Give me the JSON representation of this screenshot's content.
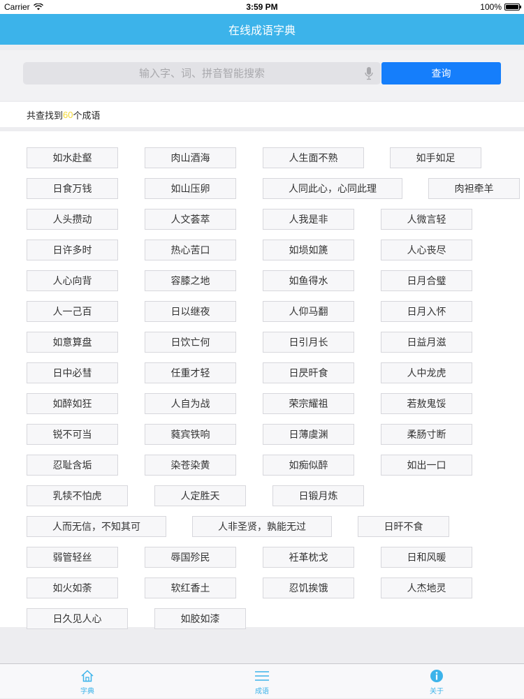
{
  "status_bar": {
    "carrier": "Carrier",
    "time": "3:59 PM",
    "battery": "100%"
  },
  "nav": {
    "title": "在线成语字典"
  },
  "search": {
    "placeholder": "输入字、词、拼音智能搜索",
    "value": "",
    "button_label": "查询"
  },
  "result": {
    "prefix": "共查找到",
    "count": "60",
    "suffix": "个成语"
  },
  "idioms": [
    "如水赴壑",
    "肉山酒海",
    "人生面不熟",
    "如手如足",
    "日食万钱",
    "如山压卵",
    "人同此心，心同此理",
    "肉袒牵羊",
    "人头攒动",
    "人文荟萃",
    "人我是非",
    "人微言轻",
    "日许多时",
    "热心苦口",
    "如埙如篪",
    "人心丧尽",
    "人心向背",
    "容膝之地",
    "如鱼得水",
    "日月合璧",
    "人一己百",
    "日以继夜",
    "人仰马翻",
    "日月入怀",
    "如意算盘",
    "日饮亡何",
    "日引月长",
    "日益月滋",
    "日中必彗",
    "任重才轻",
    "日昃旰食",
    "人中龙虎",
    "如醉如狂",
    "人自为战",
    "荣宗耀祖",
    "若敖鬼馁",
    "锐不可当",
    "蕤宾铁响",
    "日薄虞渊",
    "柔肠寸断",
    "忍耻含垢",
    "染苍染黄",
    "如痴似醉",
    "如出一口",
    "乳犊不怕虎",
    "人定胜天",
    "日锻月炼",
    "人而无信，不知其可",
    "人非圣贤，孰能无过",
    "日旰不食",
    "弱管轻丝",
    "辱国殄民",
    "衽革枕戈",
    "日和风暖",
    "如火如荼",
    "软红香土",
    "忍饥挨饿",
    "人杰地灵",
    "日久见人心",
    "如胶如漆"
  ],
  "tabs": [
    {
      "label": "字典",
      "icon": "home-icon",
      "color": "#3cb3ea"
    },
    {
      "label": "成语",
      "icon": "list-icon",
      "color": "#3cb3ea"
    },
    {
      "label": "关于",
      "icon": "info-icon",
      "color": "#3cb3ea"
    }
  ],
  "colors": {
    "nav": "#3cb3ea",
    "button": "#157efb",
    "count": "#f2d733"
  }
}
